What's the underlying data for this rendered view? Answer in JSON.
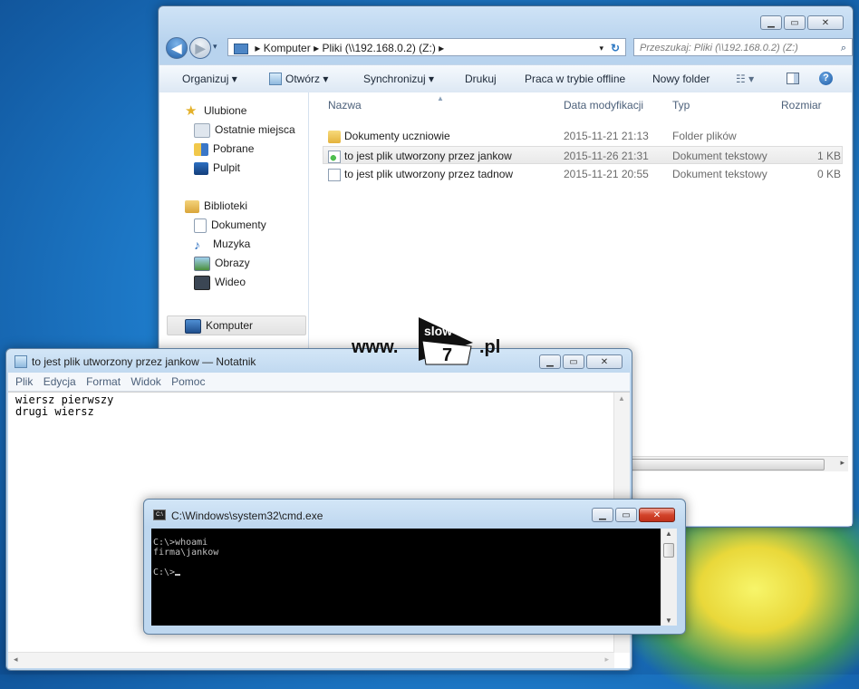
{
  "explorer": {
    "address": {
      "seg1": "Komputer",
      "seg2": "Pliki (\\\\192.168.0.2) (Z:)"
    },
    "search_placeholder": "Przeszukaj: Pliki (\\\\192.168.0.2) (Z:)",
    "toolbar": {
      "organize": "Organizuj ▾",
      "open": "Otwórz ▾",
      "sync": "Synchronizuj ▾",
      "print": "Drukuj",
      "offline": "Praca w trybie offline",
      "new_folder": "Nowy folder"
    },
    "nav": {
      "favorites": "Ulubione",
      "recent": "Ostatnie miejsca",
      "downloads": "Pobrane",
      "desktop": "Pulpit",
      "libraries": "Biblioteki",
      "documents": "Dokumenty",
      "music": "Muzyka",
      "pictures": "Obrazy",
      "video": "Wideo",
      "computer": "Komputer"
    },
    "columns": {
      "name": "Nazwa",
      "modified": "Data modyfikacji",
      "type": "Typ",
      "size": "Rozmiar"
    },
    "files": [
      {
        "name": "Dokumenty uczniowie",
        "modified": "2015-11-21 21:13",
        "type": "Folder plików",
        "size": ""
      },
      {
        "name": "to jest plik utworzony przez jankow",
        "modified": "2015-11-26 21:31",
        "type": "Dokument tekstowy",
        "size": "1 KB"
      },
      {
        "name": "to jest plik utworzony przez tadnow",
        "modified": "2015-11-21 20:55",
        "type": "Dokument tekstowy",
        "size": "0 KB"
      }
    ]
  },
  "notepad": {
    "title": "to jest plik utworzony przez jankow — Notatnik",
    "menu": {
      "file": "Plik",
      "edit": "Edycja",
      "format": "Format",
      "view": "Widok",
      "help": "Pomoc"
    },
    "line1": "wiersz pierwszy",
    "line2": "drugi wiersz"
  },
  "cmd": {
    "title": "C:\\Windows\\system32\\cmd.exe",
    "line1": "C:\\>whoami",
    "line2": "firma\\jankow",
    "prompt": "C:\\>"
  },
  "watermark": {
    "prefix": "www.",
    "tag": "slow",
    "num": "7",
    "suffix": ".pl"
  },
  "colors": {
    "desktop": "#1f7fcf",
    "close_red": "#c1311b",
    "cmd_bg": "#000000",
    "cmd_fg": "#c0c0c0"
  }
}
